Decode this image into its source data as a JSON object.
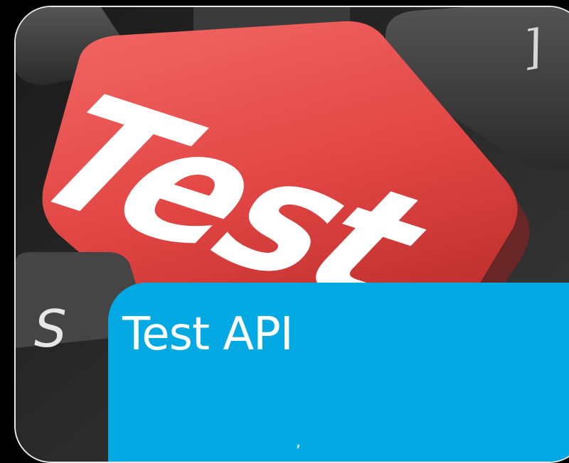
{
  "card": {
    "photo": {
      "key_label": "Test",
      "left_key_fragment": "S",
      "right_key_symbol": "]"
    },
    "caption": {
      "title": "Test API",
      "subtitle": ","
    }
  },
  "colors": {
    "background": "#000000",
    "panel": "#03a9e3",
    "key_red": "#e84a48",
    "key_dark": "#2b2b2b",
    "text": "#ffffff"
  }
}
